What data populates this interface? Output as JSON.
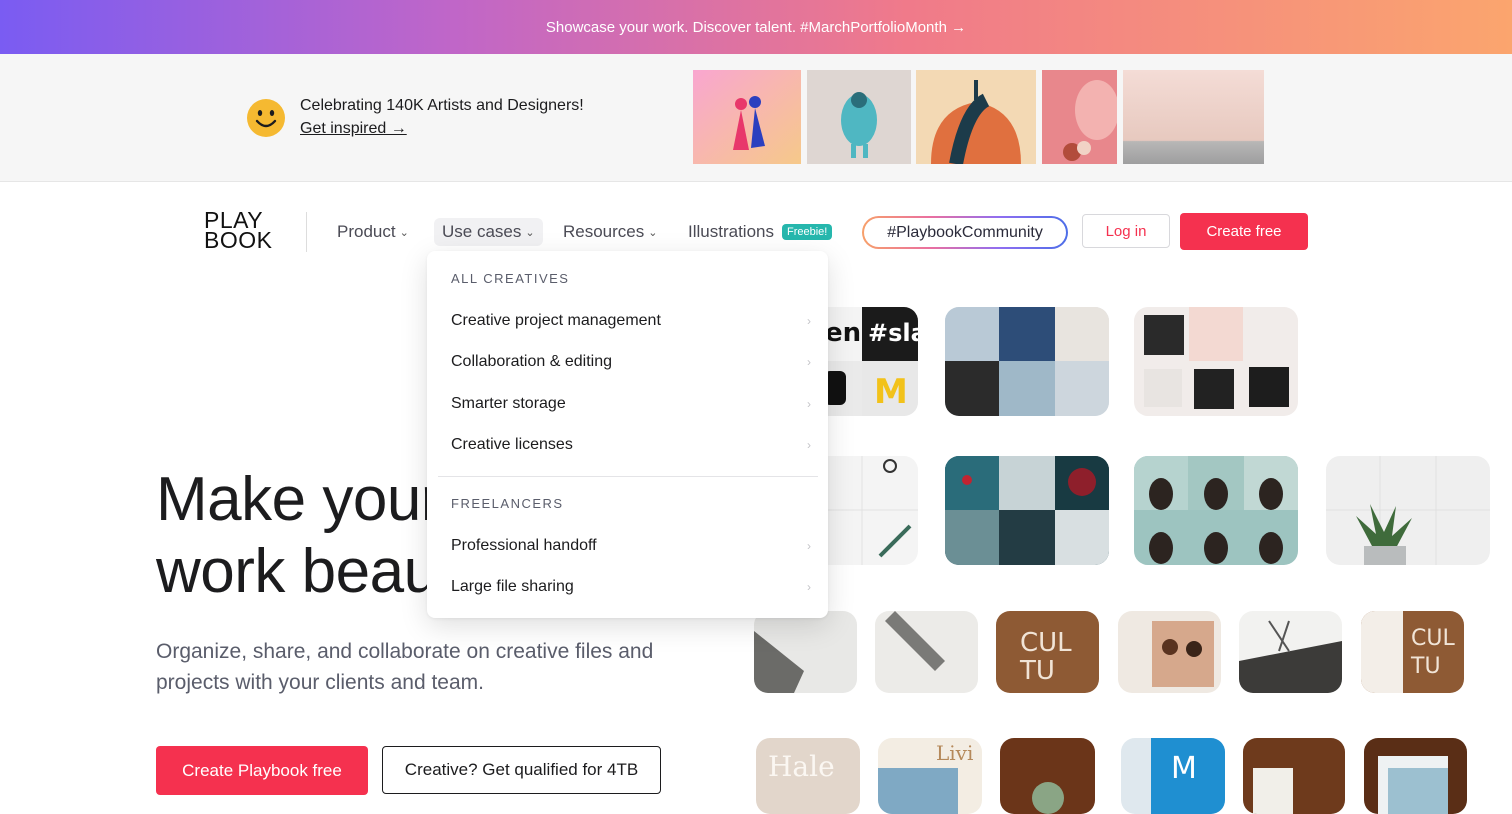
{
  "announcement": {
    "text": "Showcase your work. Discover talent. #MarchPortfolioMonth →"
  },
  "celebrate": {
    "title": "Celebrating 140K Artists and Designers!",
    "link": "Get inspired →",
    "smiley_color": "#f5b931"
  },
  "nav": {
    "logo_line1": "PLAY",
    "logo_line2": "BOOK",
    "items": [
      {
        "label": "Product",
        "icon": "chevron-down-icon"
      },
      {
        "label": "Use cases",
        "icon": "chevron-down-icon"
      },
      {
        "label": "Resources",
        "icon": "chevron-down-icon"
      },
      {
        "label": "Illustrations"
      }
    ],
    "freebie_badge": "Freebie!",
    "community": "#PlaybookCommunity",
    "login": "Log in",
    "create_free": "Create free"
  },
  "dropdown": {
    "section1": "ALL CREATIVES",
    "section1_items": [
      "Creative project management",
      "Collaboration & editing",
      "Smarter storage",
      "Creative licenses"
    ],
    "section2": "FREELANCERS",
    "section2_items": [
      "Professional handoff",
      "Large file sharing"
    ],
    "arrow_icon": "chevron-right-icon"
  },
  "hero": {
    "title_line1": "Make your",
    "title_line2": "work beau",
    "subtitle": "Organize, share, and collaborate on creative files and projects with your clients and team.",
    "cta_primary": "Create Playbook free",
    "cta_secondary": "Creative? Get qualified for 4TB"
  },
  "colors": {
    "brand_red": "#f5314f",
    "teal_badge": "#26b7ad"
  }
}
